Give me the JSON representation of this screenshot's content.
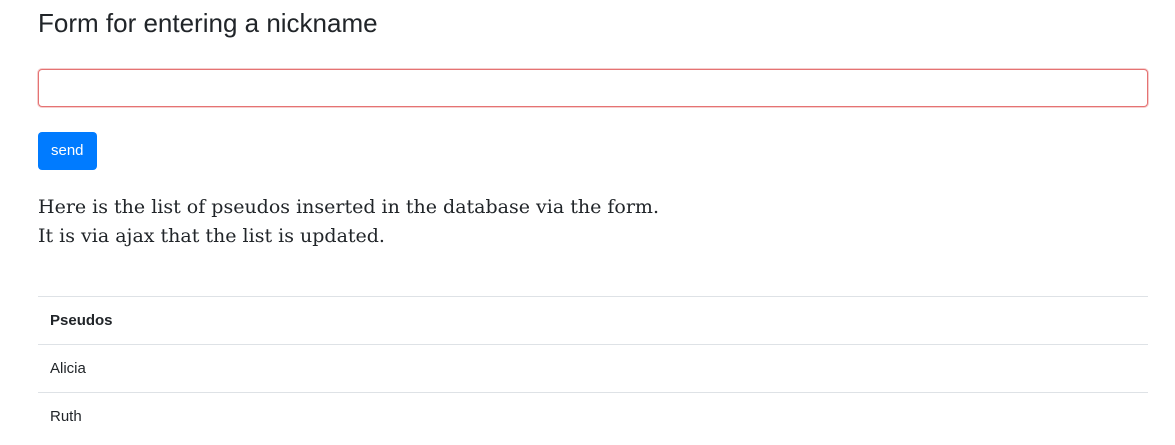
{
  "form": {
    "title": "Form for entering a nickname",
    "nickname_input": {
      "value": "",
      "placeholder": ""
    },
    "send_label": "send"
  },
  "description": {
    "line1": "Here is the list of pseudos inserted in the database via the form.",
    "line2": "It is via ajax that the list is updated."
  },
  "table": {
    "header": "Pseudos",
    "rows": [
      "Alicia",
      "Ruth"
    ]
  },
  "colors": {
    "primary": "#007bff",
    "input_invalid_border": "#e57373",
    "text": "#212529",
    "divider": "#dee2e6"
  }
}
